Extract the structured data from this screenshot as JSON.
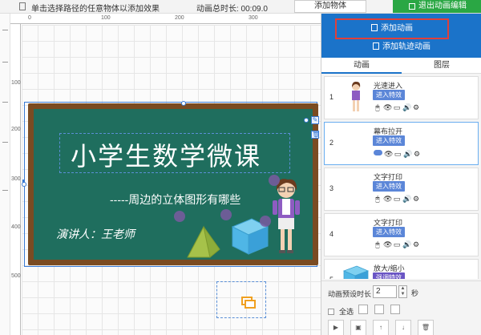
{
  "topbar": {
    "hint": "单击选择路径的任意物体以添加效果",
    "duration": "动画总时长: 00:09.0",
    "add_object_label": "添加物体",
    "exit_label": "退出动画编辑"
  },
  "ruler": {
    "top_numbers": [
      "0",
      "100",
      "200",
      "300"
    ],
    "left_numbers": [
      "100",
      "200",
      "300",
      "400",
      "500"
    ]
  },
  "board": {
    "title": "小学生数学微课",
    "subtitle": "-----周边的立体图形有哪些",
    "speaker": "演讲人：王老师"
  },
  "panel": {
    "add_animation_label": "添加动画",
    "add_track_label": "添加轨迹动画",
    "tabs": [
      "动画",
      "图层"
    ],
    "active_tab": "动画",
    "items": [
      {
        "num": "1",
        "name": "光速进入",
        "effect": "进入特效",
        "thumb": "teacher"
      },
      {
        "num": "2",
        "name": "幕布拉开",
        "effect": "进入特效",
        "thumb": "none"
      },
      {
        "num": "3",
        "name": "文字打印",
        "effect": "进入特效",
        "thumb": "none"
      },
      {
        "num": "4",
        "name": "文字打印",
        "effect": "进入特效",
        "thumb": "none"
      },
      {
        "num": "5",
        "name": "放大/缩小",
        "effect": "强调特效",
        "thumb": "cube"
      }
    ],
    "duration_label": "动画预设时长",
    "duration_value": "2",
    "duration_unit": "秒",
    "select_all_label": "全选"
  },
  "colors": {
    "panel_header": "#1b73c9",
    "exit_button": "#2aa744",
    "highlight_border": "#e0403a",
    "board_green": "#1f6e5e",
    "board_frame": "#7a4b22",
    "effect_blue": "#5b86d8",
    "effect_purple": "#6a55c4"
  }
}
